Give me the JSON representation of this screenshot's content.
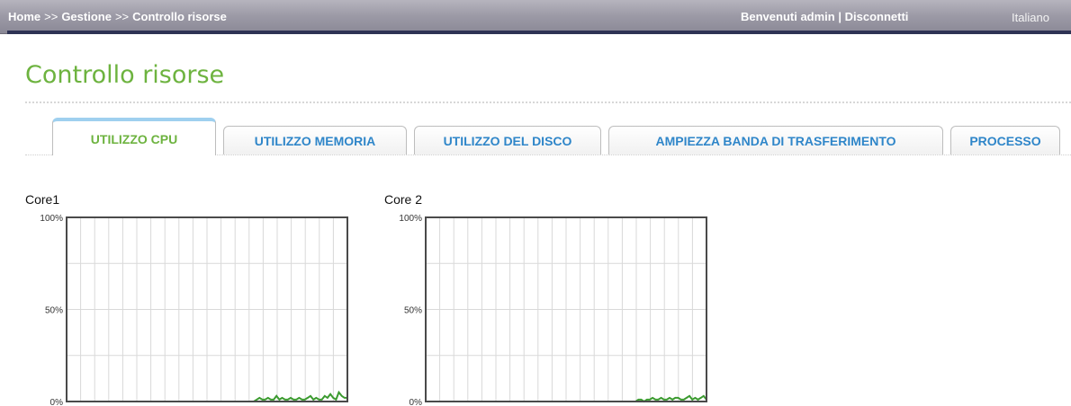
{
  "topbar": {
    "breadcrumb": [
      "Home",
      "Gestione",
      "Controllo risorse"
    ],
    "separator": ">>",
    "welcome": "Benvenuti admin",
    "divider": "|",
    "logout": "Disconnetti",
    "language": "Italiano"
  },
  "page": {
    "title": "Controllo risorse"
  },
  "tabs": [
    {
      "label": "UTILIZZO CPU",
      "active": true
    },
    {
      "label": "UTILIZZO MEMORIA",
      "active": false
    },
    {
      "label": "UTILIZZO DEL DISCO",
      "active": false
    },
    {
      "label": "AMPIEZZA BANDA DI TRASFERIMENTO",
      "active": false
    },
    {
      "label": "PROCESSO",
      "active": false
    }
  ],
  "colors": {
    "accent_green": "#6db33f",
    "tab_blue": "#2f86c9",
    "series_green": "#3b9a2f"
  },
  "chart_data": [
    {
      "type": "line",
      "title": "Core1",
      "ylabel": "",
      "yticks": [
        "100%",
        "50%",
        "0%"
      ],
      "ylim": [
        0,
        100
      ],
      "grid": true,
      "x": [
        0,
        1,
        2,
        3,
        4,
        5,
        6,
        7,
        8,
        9,
        10,
        11,
        12,
        13,
        14,
        15,
        16,
        17,
        18,
        19,
        20,
        21,
        22,
        23,
        24,
        25,
        26,
        27,
        28,
        29,
        30,
        31,
        32,
        33,
        34,
        35,
        36,
        37,
        38,
        39,
        40,
        41,
        42,
        43,
        44,
        45,
        46,
        47,
        48,
        49,
        50,
        51,
        52,
        53,
        54,
        55,
        56,
        57,
        58,
        59,
        60,
        61,
        62,
        63,
        64,
        65,
        66,
        67,
        68,
        69,
        70,
        71,
        72,
        73,
        74,
        75,
        76,
        77,
        78,
        79,
        80,
        81,
        82,
        83,
        84,
        85,
        86,
        87,
        88,
        89,
        90,
        91,
        92,
        93,
        94,
        95,
        96,
        97,
        98,
        99
      ],
      "series": [
        {
          "values": [
            0,
            0,
            0,
            0,
            0,
            0,
            0,
            0,
            0,
            0,
            0,
            0,
            0,
            0,
            0,
            0,
            0,
            0,
            0,
            0,
            0,
            0,
            0,
            0,
            0,
            0,
            0,
            0,
            0,
            0,
            0,
            0,
            0,
            0,
            0,
            0,
            0,
            0,
            0,
            0,
            0,
            0,
            0,
            0,
            0,
            0,
            0,
            0,
            0,
            0,
            0,
            0,
            0,
            0,
            0,
            0,
            0,
            0,
            0,
            0,
            0,
            0,
            0,
            0,
            0,
            0,
            0,
            1,
            2,
            1,
            1,
            2,
            1,
            1,
            3,
            1,
            2,
            1,
            1,
            2,
            1,
            1,
            2,
            1,
            1,
            2,
            3,
            1,
            2,
            1,
            1,
            3,
            2,
            4,
            2,
            1,
            5,
            3,
            2,
            2
          ]
        }
      ]
    },
    {
      "type": "line",
      "title": "Core 2",
      "ylabel": "",
      "yticks": [
        "100%",
        "50%",
        "0%"
      ],
      "ylim": [
        0,
        100
      ],
      "grid": true,
      "x": [
        0,
        1,
        2,
        3,
        4,
        5,
        6,
        7,
        8,
        9,
        10,
        11,
        12,
        13,
        14,
        15,
        16,
        17,
        18,
        19,
        20,
        21,
        22,
        23,
        24,
        25,
        26,
        27,
        28,
        29,
        30,
        31,
        32,
        33,
        34,
        35,
        36,
        37,
        38,
        39,
        40,
        41,
        42,
        43,
        44,
        45,
        46,
        47,
        48,
        49,
        50,
        51,
        52,
        53,
        54,
        55,
        56,
        57,
        58,
        59,
        60,
        61,
        62,
        63,
        64,
        65,
        66,
        67,
        68,
        69,
        70,
        71,
        72,
        73,
        74,
        75,
        76,
        77,
        78,
        79,
        80,
        81,
        82,
        83,
        84,
        85,
        86,
        87,
        88,
        89,
        90,
        91,
        92,
        93,
        94,
        95,
        96,
        97,
        98,
        99
      ],
      "series": [
        {
          "values": [
            0,
            0,
            0,
            0,
            0,
            0,
            0,
            0,
            0,
            0,
            0,
            0,
            0,
            0,
            0,
            0,
            0,
            0,
            0,
            0,
            0,
            0,
            0,
            0,
            0,
            0,
            0,
            0,
            0,
            0,
            0,
            0,
            0,
            0,
            0,
            0,
            0,
            0,
            0,
            0,
            0,
            0,
            0,
            0,
            0,
            0,
            0,
            0,
            0,
            0,
            0,
            0,
            0,
            0,
            0,
            0,
            0,
            0,
            0,
            0,
            0,
            0,
            0,
            0,
            0,
            0,
            0,
            0,
            0,
            0,
            0,
            0,
            0,
            0,
            0,
            1,
            1,
            0,
            1,
            1,
            2,
            1,
            1,
            2,
            1,
            1,
            2,
            1,
            2,
            2,
            1,
            1,
            2,
            3,
            1,
            2,
            1,
            2,
            3,
            1
          ]
        }
      ]
    }
  ]
}
